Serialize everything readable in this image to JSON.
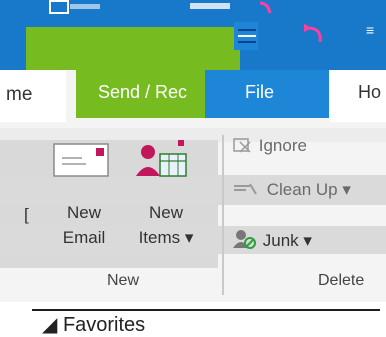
{
  "titlebar": {
    "qat_dropdown_glyph": "≡",
    "accent_blue": "#1878c9",
    "accent_green": "#76bc21"
  },
  "tabs": {
    "home_left": "me",
    "send_receive": "Send / Rec",
    "file": "File",
    "home_right": "Ho"
  },
  "ribbon": {
    "partial_left_text": "[",
    "new_email_lines": [
      "New",
      "Email"
    ],
    "new_items_lines": [
      "New",
      "Items ▾"
    ],
    "group_new_label": "New",
    "ignore_label": "Ignore",
    "cleanup_label": "Clean Up ▾",
    "junk_label": "Junk ▾",
    "group_delete_label": "Delete"
  },
  "navpane": {
    "favorites_label": "◢ Favorites"
  }
}
